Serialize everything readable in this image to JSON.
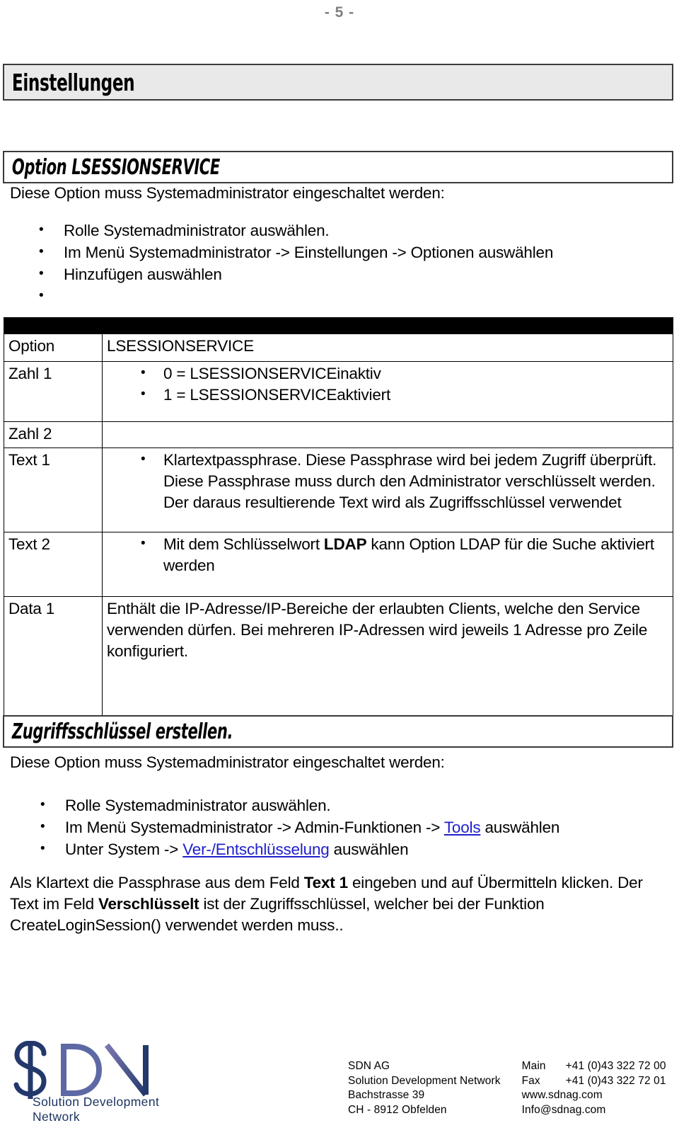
{
  "page": {
    "number_label": "- 5 -"
  },
  "headings": {
    "main": "Einstellungen",
    "section_option": "Option LSESSIONSERVICE",
    "section_zugriff": "Zugriffsschlüssel erstellen."
  },
  "intro": {
    "option_text": "Diese Option muss Systemadministrator eingeschaltet werden:",
    "zugriff_text": "Diese Option muss Systemadministrator eingeschaltet werden:"
  },
  "list_option": [
    "Rolle Systemadministrator auswählen.",
    "Im Menü Systemadministrator -> Einstellungen -> Optionen auswählen",
    "Hinzufügen auswählen",
    ""
  ],
  "list_zugriff": {
    "item1": "Rolle Systemadministrator auswählen.",
    "item2_pre": "Im Menü Systemadministrator -> Admin-Funktionen -> ",
    "item2_link": "Tools",
    "item2_post": " auswählen",
    "item3_pre": "Unter System -> ",
    "item3_link": "Ver-/Entschlüsselung",
    "item3_post": " auswählen"
  },
  "table": {
    "rows": {
      "option": {
        "label": "Option",
        "value": "LSESSIONSERVICE"
      },
      "zahl1": {
        "label": "Zahl 1",
        "bullets": [
          "0 = LSESSIONSERVICEinaktiv",
          "1 = LSESSIONSERVICEaktiviert"
        ]
      },
      "zahl2": {
        "label": "Zahl 2",
        "value": ""
      },
      "text1": {
        "label": "Text 1",
        "bullet": "Klartextpassphrase. Diese Passphrase wird bei jedem Zugriff überprüft. Diese Passphrase muss durch den Administrator verschlüsselt werden. Der daraus resultierende Text wird als Zugriffsschlüssel verwendet"
      },
      "text2": {
        "label": "Text 2",
        "bullet_pre": "Mit dem Schlüsselwort ",
        "bullet_bold": "LDAP",
        "bullet_post": " kann Option LDAP für die Suche aktiviert werden"
      },
      "data1": {
        "label": "Data 1",
        "value": "Enthält die IP-Adresse/IP-Bereiche der erlaubten Clients, welche den Service verwenden dürfen. Bei mehreren IP-Adressen wird jeweils 1 Adresse pro Zeile konfiguriert."
      }
    }
  },
  "final_paragraph": {
    "part1": "Als Klartext die Passphrase aus dem Feld ",
    "bold1": "Text 1",
    "part2": " eingeben und auf Übermitteln klicken. Der Text im Feld ",
    "bold2": "Verschlüsselt",
    "part3": " ist der Zugriffsschlüssel, welcher bei der Funktion CreateLoginSession() verwendet werden muss.."
  },
  "logo": {
    "mark_text": "SDN",
    "caption": "Solution Development Network",
    "color_s": "#23386b",
    "color_d": "#5d69a4",
    "color_n_start": "#6f6fa8",
    "color_n_end": "#23386b"
  },
  "footer": {
    "address": {
      "line1": "SDN AG",
      "line2": "Solution Development Network",
      "line3": "Bachstrasse 39",
      "line4": "CH - 8912 Obfelden"
    },
    "contact": {
      "main_label": "Main",
      "main_value": "+41 (0)43 322 72 00",
      "fax_label": "Fax",
      "fax_value": "+41 (0)43 322 72 01",
      "web": "www.sdnag.com",
      "email": "Info@sdnag.com"
    }
  }
}
